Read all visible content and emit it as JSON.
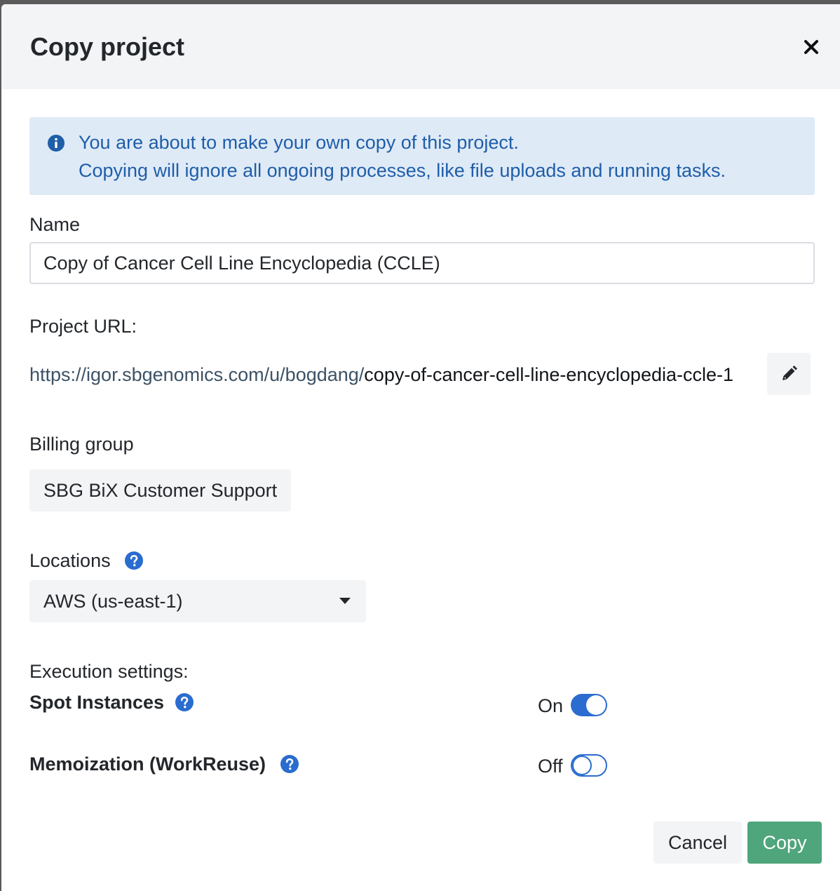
{
  "dialog": {
    "title": "Copy project"
  },
  "info": {
    "line1": "You are about to make your own copy of this project.",
    "line2": "Copying will ignore all ongoing processes, like file uploads and running tasks."
  },
  "name_field": {
    "label": "Name",
    "value": "Copy of Cancer Cell Line Encyclopedia (CCLE)"
  },
  "project_url": {
    "label": "Project URL:",
    "base": "https://igor.sbgenomics.com/u/bogdang/",
    "slug": "copy-of-cancer-cell-line-encyclopedia-ccle-1"
  },
  "billing": {
    "label": "Billing group",
    "value": "SBG BiX Customer Support"
  },
  "locations": {
    "label": "Locations",
    "selected": "AWS (us-east-1)"
  },
  "execution": {
    "label": "Execution settings:",
    "spot_instances": {
      "title": "Spot Instances",
      "state_label": "On",
      "enabled": true
    },
    "memoization": {
      "title": "Memoization (WorkReuse)",
      "state_label": "Off",
      "enabled": false
    }
  },
  "footer": {
    "cancel_label": "Cancel",
    "copy_label": "Copy"
  },
  "colors": {
    "accent_blue": "#2a6ccf",
    "info_bg": "#dfeaf7",
    "info_text": "#1f5ea8",
    "copy_button": "#4fa57c"
  },
  "icons": {
    "close": "close-icon",
    "info": "info-icon",
    "edit": "pencil-icon",
    "help": "question-circle-icon",
    "caret": "caret-down-icon"
  }
}
